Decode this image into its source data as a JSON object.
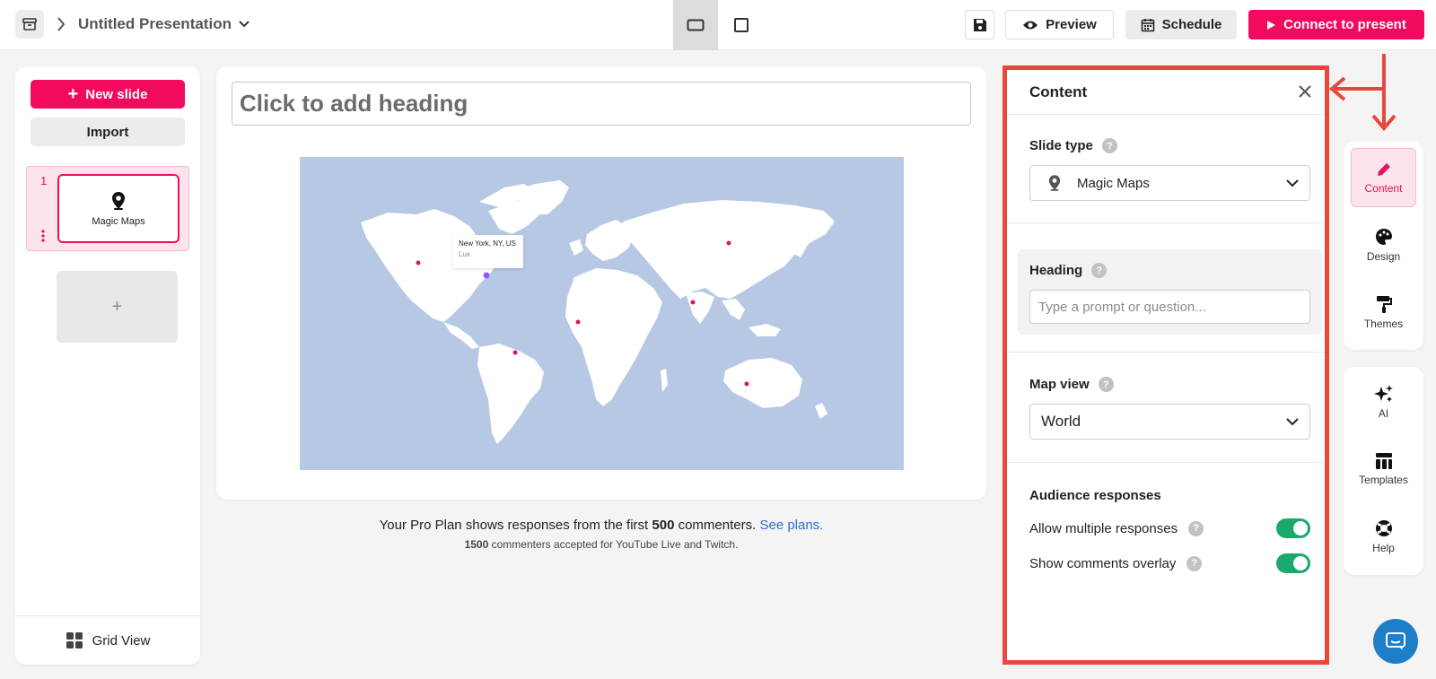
{
  "topbar": {
    "title": "Untitled Presentation",
    "preview_label": "Preview",
    "schedule_label": "Schedule",
    "connect_label": "Connect to present"
  },
  "left_panel": {
    "new_slide_label": "New slide",
    "import_label": "Import",
    "slides": [
      {
        "number": "1",
        "label": "Magic Maps",
        "icon": "map-pin-icon"
      }
    ],
    "add_slide_label": "+",
    "grid_view_label": "Grid View"
  },
  "canvas": {
    "heading_placeholder": "Click to add heading",
    "map": {
      "background_color": "#b6c8e4",
      "land_color": "#ffffff",
      "tooltip_title": "New York, NY, US",
      "tooltip_sub": "Lux"
    },
    "plan_note": {
      "prefix": "Your Pro Plan shows responses from the first",
      "count": "500",
      "suffix": "commenters.",
      "link": "See plans.",
      "line2_count": "1500",
      "line2_text": "commenters accepted for YouTube Live and Twitch."
    }
  },
  "content_panel": {
    "title": "Content",
    "slide_type_label": "Slide type",
    "slide_type_value": "Magic Maps",
    "heading_label": "Heading",
    "heading_placeholder": "Type a prompt or question...",
    "map_view_label": "Map view",
    "map_view_value": "World",
    "audience_label": "Audience responses",
    "allow_multiple_label": "Allow multiple responses",
    "allow_multiple_on": true,
    "show_overlay_label": "Show comments overlay",
    "show_overlay_on": true,
    "help_glyph": "?"
  },
  "right_rail": {
    "items_top": [
      {
        "label": "Content",
        "icon": "pencil-icon",
        "active": true
      },
      {
        "label": "Design",
        "icon": "palette-icon",
        "active": false
      },
      {
        "label": "Themes",
        "icon": "paint-roller-icon",
        "active": false
      }
    ],
    "items_bottom": [
      {
        "label": "AI",
        "icon": "sparkles-icon"
      },
      {
        "label": "Templates",
        "icon": "templates-icon"
      },
      {
        "label": "Help",
        "icon": "lifebuoy-icon"
      }
    ]
  },
  "colors": {
    "brand": "#f20a5e",
    "annotation_red": "#e8473d",
    "toggle_on": "#1aa86b",
    "link": "#2f6fce"
  }
}
